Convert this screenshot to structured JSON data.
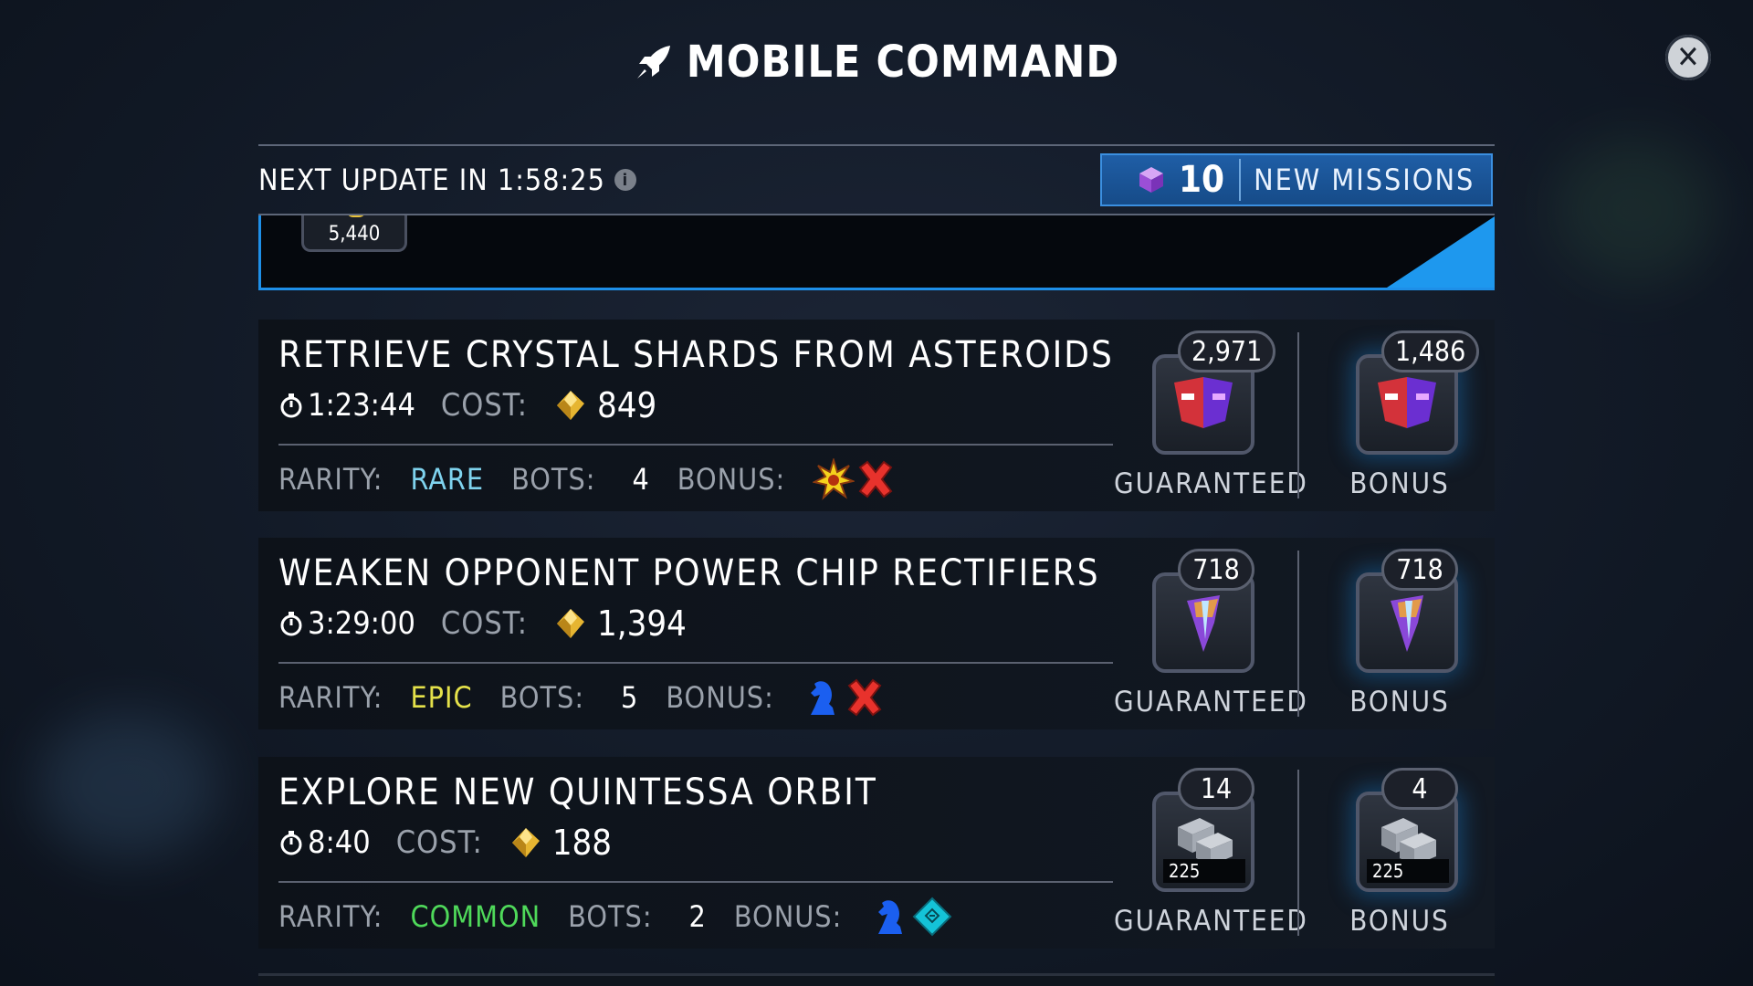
{
  "header": {
    "title": "MOBILE COMMAND"
  },
  "update_bar": {
    "next_update_label": "NEXT UPDATE IN 1:58:25",
    "new_missions_count": "10",
    "new_missions_label": "NEW MISSIONS"
  },
  "partial_card": {
    "value": "5,440"
  },
  "missions": [
    {
      "title": "RETRIEVE CRYSTAL SHARDS FROM ASTEROIDS",
      "time": "1:23:44",
      "cost_label": "COST:",
      "cost": "849",
      "rarity_label": "RARITY:",
      "rarity": "RARE",
      "rarity_color": "#7fd3ee",
      "bots_label": "BOTS:",
      "bots": "4",
      "bonus_label": "BONUS:",
      "bonus_icons": [
        "explosion-icon",
        "red-cross-icon"
      ],
      "guaranteed": {
        "count": "2,971",
        "label": "GUARANTEED",
        "icon": "faction-shard-icon"
      },
      "bonus": {
        "count": "1,486",
        "label": "BONUS",
        "icon": "faction-shard-icon"
      }
    },
    {
      "title": "WEAKEN OPPONENT POWER CHIP RECTIFIERS",
      "time": "3:29:00",
      "cost_label": "COST:",
      "cost": "1,394",
      "rarity_label": "RARITY:",
      "rarity": "EPIC",
      "rarity_color": "#e4e14a",
      "bots_label": "BOTS:",
      "bots": "5",
      "bonus_label": "BONUS:",
      "bonus_icons": [
        "blue-knight-icon",
        "red-cross-icon"
      ],
      "guaranteed": {
        "count": "718",
        "label": "GUARANTEED",
        "icon": "crystal-spike-icon"
      },
      "bonus": {
        "count": "718",
        "label": "BONUS",
        "icon": "crystal-spike-icon"
      }
    },
    {
      "title": "EXPLORE NEW QUINTESSA ORBIT",
      "time": "8:40",
      "cost_label": "COST:",
      "cost": "188",
      "rarity_label": "RARITY:",
      "rarity": "COMMON",
      "rarity_color": "#4fd95a",
      "bots_label": "BOTS:",
      "bots": "2",
      "bonus_label": "BONUS:",
      "bonus_icons": [
        "blue-knight-icon",
        "tech-diamond-icon"
      ],
      "guaranteed": {
        "count": "14",
        "label": "GUARANTEED",
        "icon": "metal-bars-icon",
        "sub_count": "225"
      },
      "bonus": {
        "count": "4",
        "label": "BONUS",
        "icon": "metal-bars-icon",
        "sub_count": "225"
      }
    }
  ],
  "colors": {
    "accent_blue": "#1e98ee",
    "gold": "#e8c23a"
  }
}
